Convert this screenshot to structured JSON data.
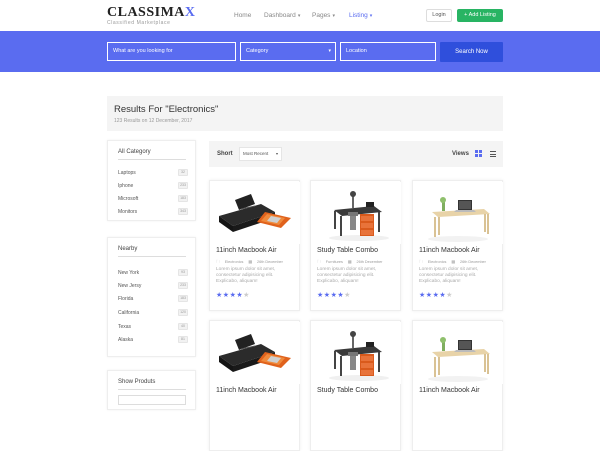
{
  "brand": {
    "name": "CLASSIMAX",
    "tagline": "Classified Marketplace"
  },
  "nav": {
    "home": "Home",
    "dashboard": "Dashboard",
    "pages": "Pages",
    "listing": "Listing",
    "login": "Login",
    "add_listing": "Add Listing"
  },
  "search": {
    "what_placeholder": "What are you looking for",
    "category_placeholder": "Category",
    "location_placeholder": "Location",
    "button": "Search Now"
  },
  "results": {
    "title": "Results For \"Electronics\"",
    "subtitle": "123 Results on 12 December, 2017"
  },
  "sidebar": {
    "categories": {
      "title": "All Category",
      "items": [
        {
          "label": "Laptops",
          "count": "32"
        },
        {
          "label": "Iphone",
          "count": "233"
        },
        {
          "label": "Microsoft",
          "count": "183"
        },
        {
          "label": "Monitors",
          "count": "343"
        }
      ]
    },
    "nearby": {
      "title": "Nearby",
      "items": [
        {
          "label": "New York",
          "count": "93"
        },
        {
          "label": "New Jersy",
          "count": "233"
        },
        {
          "label": "Florida",
          "count": "183"
        },
        {
          "label": "California",
          "count": "120"
        },
        {
          "label": "Texas",
          "count": "40"
        },
        {
          "label": "Alaska",
          "count": "81"
        }
      ]
    },
    "show": {
      "title": "Show Produts"
    }
  },
  "toolbar": {
    "sort_label": "Short",
    "sort_value": "Most Recent",
    "views_label": "Views"
  },
  "colors": {
    "accent": "#5a6cf0",
    "search_button": "#2f4fdc",
    "add_button": "#28b463",
    "star_off": "#cccccc"
  },
  "cards": [
    {
      "title": "11inch Macbook Air",
      "category": "Electronics",
      "date": "26th December",
      "desc": "Lorem ipsum dolor sit amet, consectetur adipisicing elit. Explicabo, aliquam!",
      "rating": 4,
      "image": "laptop-bag"
    },
    {
      "title": "Study Table Combo",
      "category": "Furnitures",
      "date": "26th December",
      "desc": "Lorem ipsum dolor sit amet, consectetur adipisicing elit. Explicabo, aliquam!",
      "rating": 4,
      "image": "study-table"
    },
    {
      "title": "11inch Macbook Air",
      "category": "Electronics",
      "date": "26th December",
      "desc": "Lorem ipsum dolor sit amet, consectetur adipisicing elit. Explicabo, aliquam!",
      "rating": 4,
      "image": "desk-laptop"
    },
    {
      "title": "11inch Macbook Air",
      "category": "",
      "date": "",
      "desc": "",
      "rating": 0,
      "image": "laptop-bag"
    },
    {
      "title": "Study Table Combo",
      "category": "",
      "date": "",
      "desc": "",
      "rating": 0,
      "image": "study-table"
    },
    {
      "title": "11inch Macbook Air",
      "category": "",
      "date": "",
      "desc": "",
      "rating": 0,
      "image": "desk-laptop"
    }
  ]
}
